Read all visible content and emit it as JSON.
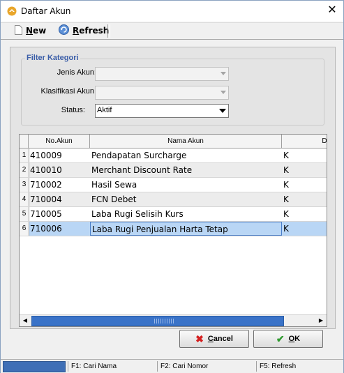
{
  "window": {
    "title": "Daftar Akun",
    "close_glyph": "✕"
  },
  "toolbar": {
    "new_label": "New",
    "refresh_label": "Refresh"
  },
  "filter": {
    "legend": "Filter Kategori",
    "jenis_label": "Jenis Akun:",
    "jenis_value": "",
    "klasifikasi_label": "Klasifikasi Akun:",
    "klasifikasi_value": "",
    "status_label": "Status:",
    "status_value": "Aktif"
  },
  "grid": {
    "headers": [
      "No.Akun",
      "Nama Akun",
      "D/K"
    ],
    "rows": [
      {
        "num": "1",
        "no": "410009",
        "nama": "Pendapatan Surcharge",
        "dk": "K"
      },
      {
        "num": "2",
        "no": "410010",
        "nama": "Merchant Discount Rate",
        "dk": "K"
      },
      {
        "num": "3",
        "no": "710002",
        "nama": "Hasil Sewa",
        "dk": "K"
      },
      {
        "num": "4",
        "no": "710004",
        "nama": "FCN Debet",
        "dk": "K"
      },
      {
        "num": "5",
        "no": "710005",
        "nama": "Laba Rugi Selisih Kurs",
        "dk": "K"
      },
      {
        "num": "6",
        "no": "710006",
        "nama": "Laba Rugi Penjualan Harta Tetap",
        "dk": "K"
      }
    ],
    "selected_row": 6
  },
  "buttons": {
    "cancel_label": "Cancel",
    "ok_label": "OK"
  },
  "statusbar": {
    "f1": "F1: Cari Nama",
    "f2": "F2: Cari Nomor",
    "f5": "F5: Refresh"
  },
  "colors": {
    "accent": "#3f6fb6",
    "selection": "#b9d6f5",
    "legend": "#3b5ea8"
  }
}
